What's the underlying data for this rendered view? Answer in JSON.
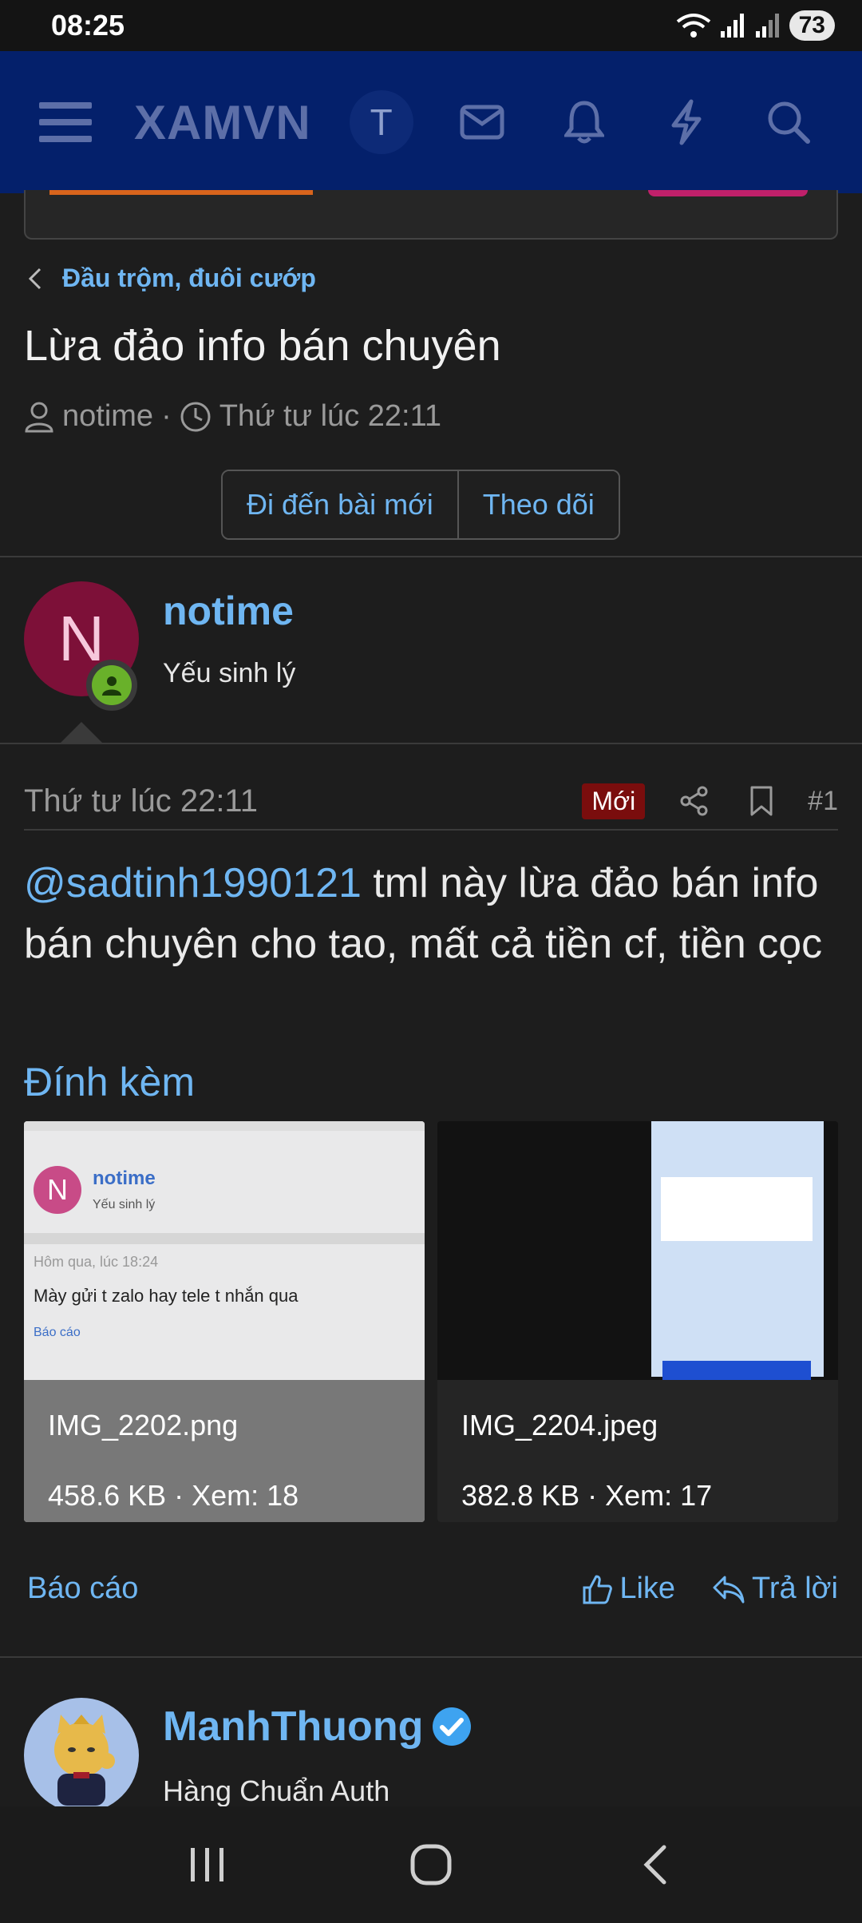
{
  "status_bar": {
    "time": "08:25",
    "battery": "73"
  },
  "header": {
    "logo": "XAMVN",
    "avatar_letter": "T"
  },
  "breadcrumb": {
    "label": "Đầu trộm, đuôi cướp"
  },
  "thread": {
    "title": "Lừa đảo info bán chuyên",
    "author": "notime",
    "separator": "·",
    "time": "Thứ tư lúc 22:11",
    "buttons": {
      "go_to_new": "Đi đến bài mới",
      "follow": "Theo dõi"
    }
  },
  "post": {
    "user": {
      "avatar_letter": "N",
      "name": "notime",
      "title": "Yếu sinh lý"
    },
    "date": "Thứ tư lúc 22:11",
    "new_badge": "Mới",
    "number": "#1",
    "mention": "@sadtinh1990121",
    "body": " tml này lừa đảo bán info bán chuyên cho tao, mất cả tiền cf, tiền cọc",
    "attachments_title": "Đính kèm",
    "attachments": [
      {
        "name": "IMG_2202.png",
        "info": "458.6 KB · Xem: 18"
      },
      {
        "name": "IMG_2204.jpeg",
        "info": "382.8 KB · Xem: 17"
      }
    ],
    "actions": {
      "report": "Báo cáo",
      "like": "Like",
      "reply": "Trả lời"
    }
  },
  "thumbnail_1": {
    "name": "notime",
    "subtitle": "Yếu sinh lý",
    "date": "Hôm qua, lúc 18:24",
    "text": "Mày gửi t zalo hay tele t nhắn qua",
    "report": "Báo cáo"
  },
  "next_post": {
    "name": "ManhThuong",
    "title": "Hàng Chuẩn Auth"
  },
  "colors": {
    "header_bg": "#04206b",
    "link": "#6fb6f2",
    "new_badge": "#7a0d0d",
    "online": "#69b12a"
  }
}
